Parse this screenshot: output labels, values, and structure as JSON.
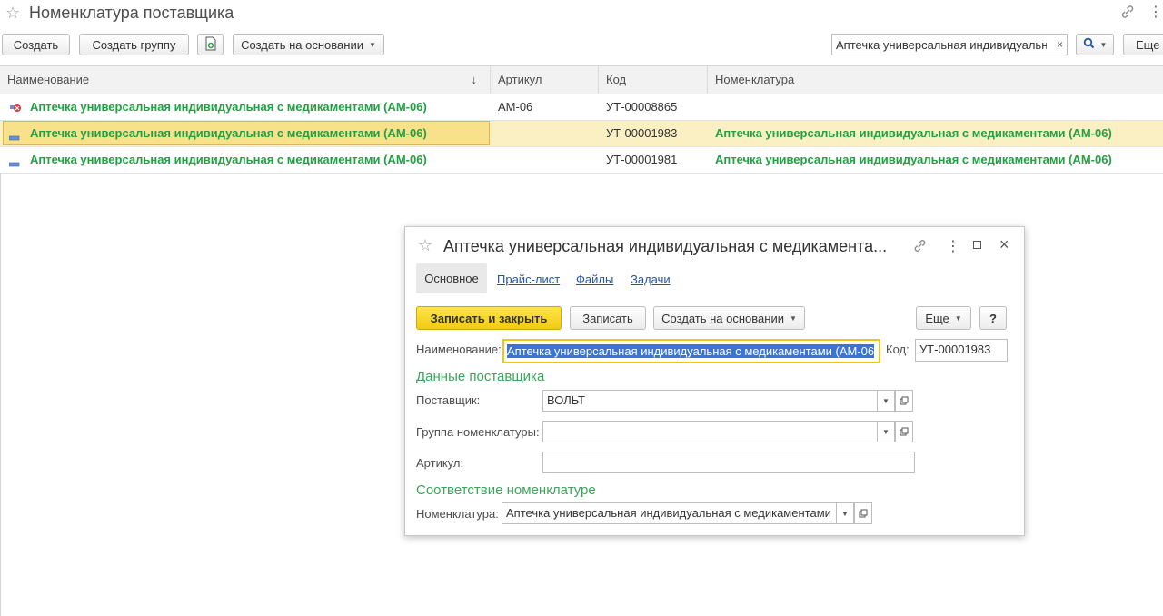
{
  "window": {
    "title": "Номенклатура поставщика"
  },
  "toolbar": {
    "create": "Создать",
    "create_group": "Создать группу",
    "create_based_on": "Создать на основании",
    "more": "Еще"
  },
  "search": {
    "value": "Аптечка универсальная индивидуальн",
    "clear": "×"
  },
  "grid": {
    "columns": [
      "Наименование",
      "Артикул",
      "Код",
      "Номенклатура"
    ],
    "sort_indicator": "↓",
    "rows": [
      {
        "name": "Аптечка универсальная индивидуальная с медикаментами (АМ-06)",
        "article": "АМ-06",
        "code": "УТ-00008865",
        "nomenclature": ""
      },
      {
        "name": "Аптечка универсальная индивидуальная с медикаментами (АМ-06)",
        "article": "",
        "code": "УТ-00001983",
        "nomenclature": "Аптечка универсальная индивидуальная с медикаментами (АМ-06)"
      },
      {
        "name": "Аптечка универсальная индивидуальная с медикаментами (АМ-06)",
        "article": "",
        "code": "УТ-00001981",
        "nomenclature": "Аптечка универсальная индивидуальная с медикаментами (АМ-06)"
      }
    ]
  },
  "dialog": {
    "title": "Аптечка универсальная индивидуальная с медикамента...",
    "tabs": [
      "Основное",
      "Прайс-лист",
      "Файлы",
      "Задачи"
    ],
    "buttons": {
      "save_close": "Записать и закрыть",
      "save": "Записать",
      "create_based_on": "Создать на основании",
      "more": "Еще",
      "help": "?"
    },
    "name_label": "Наименование:",
    "name_value": "Аптечка универсальная индивидуальная с медикаментами (АМ-06",
    "code_label": "Код:",
    "code_value": "УТ-00001983",
    "supplier_section": "Данные поставщика",
    "supplier_label": "Поставщик:",
    "supplier_value": "ВОЛЬТ",
    "group_label": "Группа номенклатуры:",
    "group_value": "",
    "article_label": "Артикул:",
    "article_value": "",
    "match_section": "Соответствие номенклатуре",
    "nomenclature_label": "Номенклатура:",
    "nomenclature_value": "Аптечка универсальная индивидуальная с медикаментами"
  },
  "colors": {
    "accent_green": "#22a044",
    "selection": "#fbf0c4",
    "primary_button": "#f5d31c",
    "link": "#2355a6"
  }
}
